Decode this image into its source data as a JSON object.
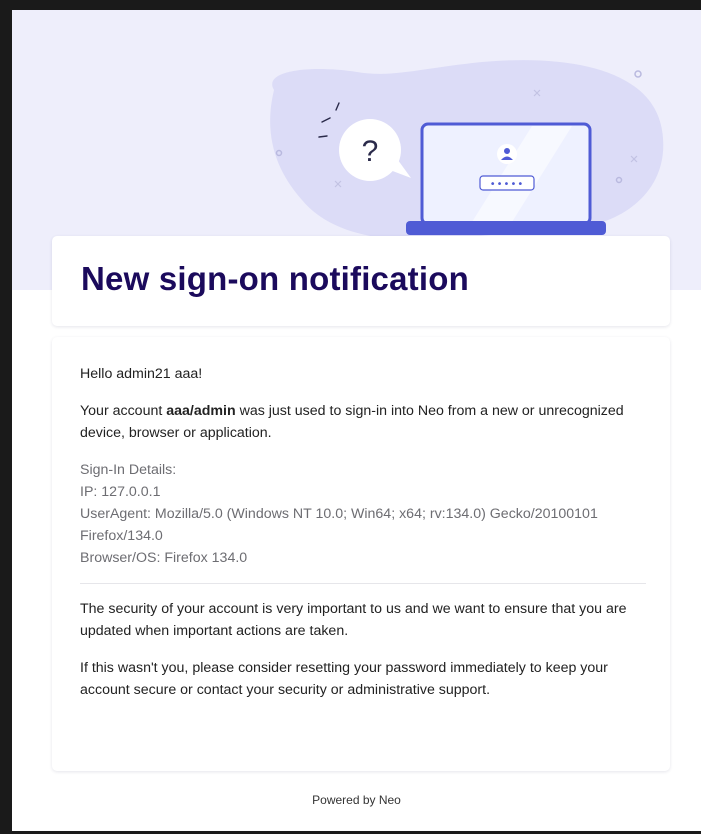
{
  "title": "New sign-on notification",
  "greeting": "Hello admin21 aaa!",
  "intro": {
    "prefix": "Your account ",
    "account": "aaa/admin",
    "suffix": " was just used to sign-in into Neo from a new or unrecognized device, browser or application."
  },
  "details": {
    "heading": "Sign-In Details:",
    "ip": "IP: 127.0.0.1",
    "user_agent": "UserAgent: Mozilla/5.0 (Windows NT 10.0; Win64; x64; rv:134.0) Gecko/20100101 Firefox/134.0",
    "browser_os": "Browser/OS: Firefox 134.0"
  },
  "security_note": "The security of your account is very important to us and we want to ensure that you are updated when important actions are taken.",
  "warning_note": "If this wasn't you, please consider resetting your password immediately to keep your account secure or contact your security or administrative support.",
  "footer": "Powered by Neo",
  "illustration": {
    "icons": [
      "question-bubble-icon",
      "laptop-icon",
      "user-avatar-icon",
      "password-dots-icon"
    ],
    "password_mask": "•••••",
    "question_mark": "?"
  },
  "colors": {
    "band": "#eeeefb",
    "blob": "#dcdcf7",
    "title": "#1b0a5c",
    "accent": "#4f5bd5"
  }
}
